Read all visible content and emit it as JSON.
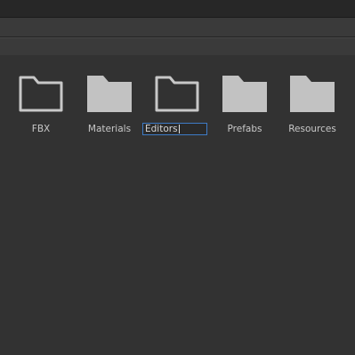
{
  "colors": {
    "background": "#323232",
    "folder_fill": "#c2c2c2",
    "folder_outline": "#c8c8c8",
    "label_text": "#c8c8c8",
    "rename_border": "#3e7bc6"
  },
  "folders": [
    {
      "label": "FBX",
      "icon": "folder-empty-icon",
      "empty": true
    },
    {
      "label": "Materials",
      "icon": "folder-icon",
      "empty": false
    },
    {
      "label": "Editors",
      "icon": "folder-empty-icon",
      "empty": true,
      "renaming": true
    },
    {
      "label": "Prefabs",
      "icon": "folder-icon",
      "empty": false
    },
    {
      "label": "Resources",
      "icon": "folder-icon",
      "empty": false
    }
  ]
}
